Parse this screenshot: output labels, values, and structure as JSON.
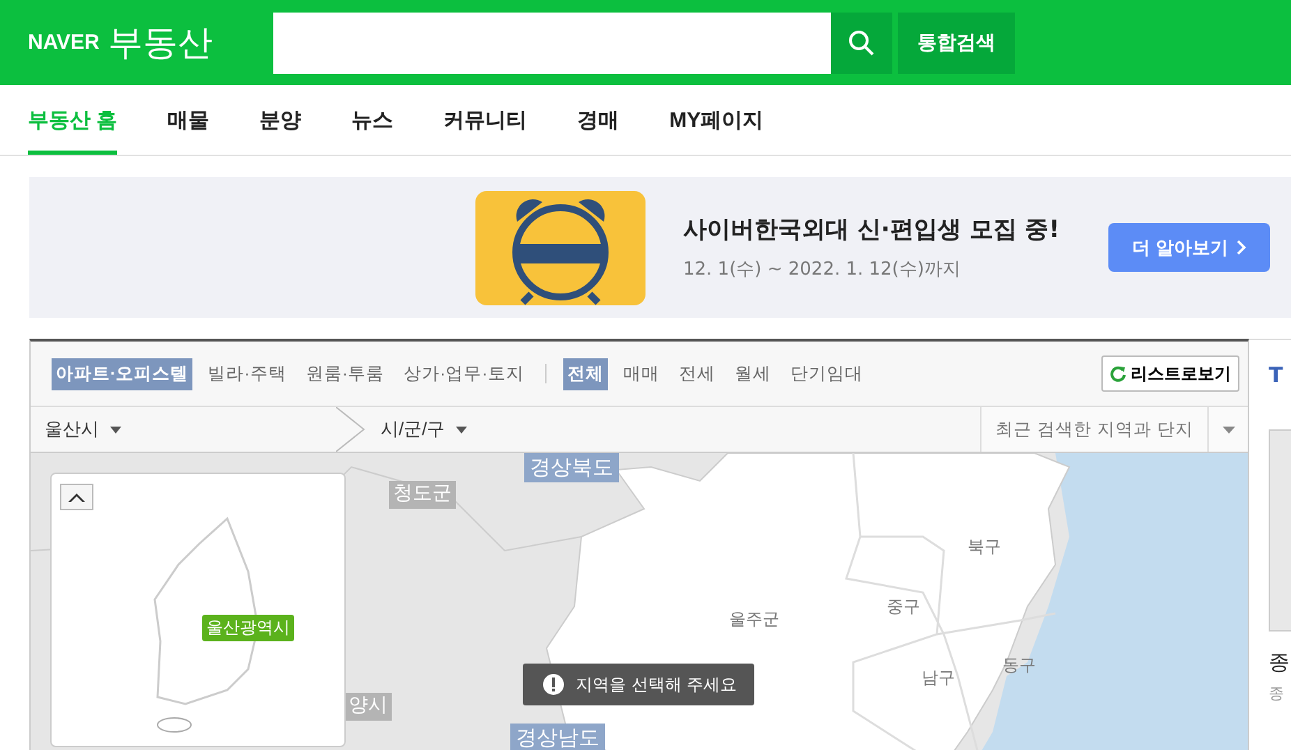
{
  "header": {
    "logo": "NAVER",
    "service": "부동산",
    "search_button": "통합검색"
  },
  "nav": [
    {
      "label": "부동산 홈",
      "selected": true
    },
    {
      "label": "매물",
      "selected": false
    },
    {
      "label": "분양",
      "selected": false
    },
    {
      "label": "뉴스",
      "selected": false
    },
    {
      "label": "커뮤니티",
      "selected": false
    },
    {
      "label": "경매",
      "selected": false
    },
    {
      "label": "MY페이지",
      "selected": false
    }
  ],
  "banner": {
    "title": "사이버한국외대 신·편입생 모집 중!",
    "dates": "12. 1(수) ~ 2022. 1. 12(수)까지",
    "button": "더 알아보기"
  },
  "filter": {
    "property_types": [
      {
        "label": "아파트·오피스텔",
        "selected": true
      },
      {
        "label": "빌라·주택",
        "selected": false
      },
      {
        "label": "원룸·투룸",
        "selected": false
      },
      {
        "label": "상가·업무·토지",
        "selected": false
      }
    ],
    "deal_types": [
      {
        "label": "전체",
        "selected": true
      },
      {
        "label": "매매",
        "selected": false
      },
      {
        "label": "전세",
        "selected": false
      },
      {
        "label": "월세",
        "selected": false
      },
      {
        "label": "단기임대",
        "selected": false
      }
    ],
    "list_button": "리스트로보기"
  },
  "location": {
    "city": "울산시",
    "district": "시/군/구",
    "recent_placeholder": "최근 검색한 지역과 단지"
  },
  "map": {
    "labels": [
      {
        "text": "경상북도",
        "kind": "province"
      },
      {
        "text": "청도군",
        "kind": "neighbor"
      },
      {
        "text": "양시",
        "kind": "neighbor"
      },
      {
        "text": "경상남도",
        "kind": "province"
      },
      {
        "text": "울주군",
        "kind": "district"
      },
      {
        "text": "북구",
        "kind": "district"
      },
      {
        "text": "중구",
        "kind": "district"
      },
      {
        "text": "남구",
        "kind": "district"
      },
      {
        "text": "동구",
        "kind": "district"
      }
    ],
    "inset_label": "울산광역시",
    "toast": "지역을 선택해 주세요"
  },
  "side": {
    "heading": "T",
    "item_title": "종",
    "item_sub": "종"
  }
}
